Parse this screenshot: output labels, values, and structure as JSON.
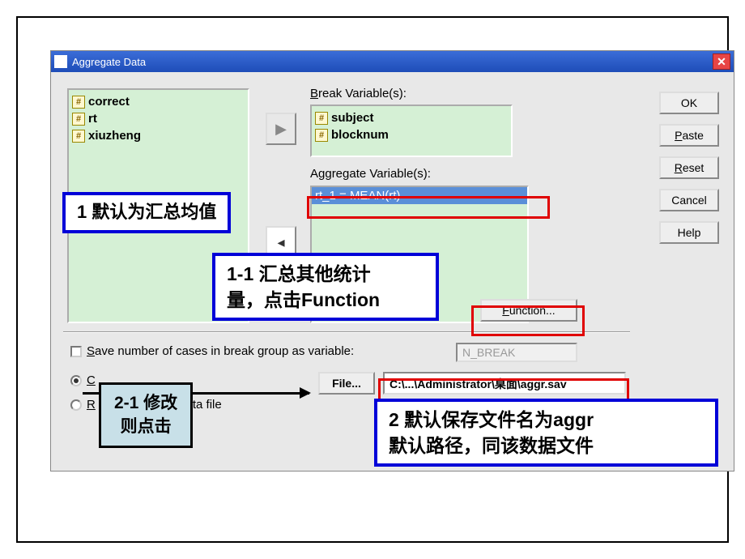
{
  "window": {
    "title": "Aggregate Data"
  },
  "source_vars": [
    "correct",
    "rt",
    "xiuzheng"
  ],
  "break": {
    "label": "Break Variable(s):",
    "items": [
      "subject",
      "blocknum"
    ]
  },
  "aggregate": {
    "label": "Aggregate Variable(s):",
    "items": [
      "rt_1 = MEAN(rt)"
    ]
  },
  "buttons": {
    "ok": "OK",
    "paste": "Paste",
    "reset": "Reset",
    "cancel": "Cancel",
    "help": "Help",
    "function": "Function...",
    "file": "File..."
  },
  "save_cases": {
    "label": "Save number of cases in break group as variable:",
    "var": "N_BREAK"
  },
  "radio": {
    "opt1_visible": "C",
    "opt2_visible": "R",
    "opt2_tail": "ta file"
  },
  "path": "C:\\...\\Administrator\\桌面\\aggr.sav",
  "annotations": {
    "a1": "1  默认为汇总均值",
    "a1_1_line1": "1-1  汇总其他统计",
    "a1_1_line2": "量，点击Function",
    "a2_1_line1": "2-1  修改",
    "a2_1_line2": "则点击",
    "a2_line1": "2  默认保存文件名为aggr",
    "a2_line2": "默认路径，同该数据文件"
  }
}
